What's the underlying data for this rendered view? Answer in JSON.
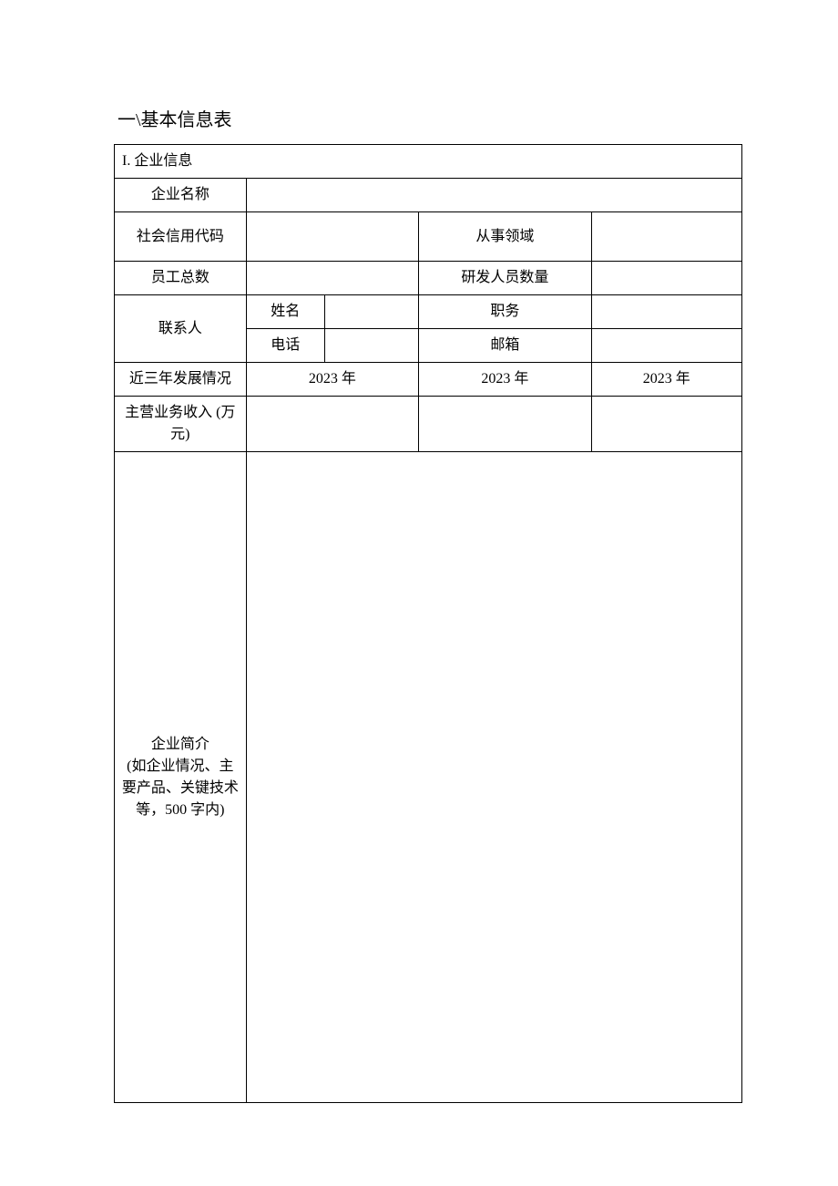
{
  "title": "一\\基本信息表",
  "section": "I. 企业信息",
  "labels": {
    "companyName": "企业名称",
    "creditCode": "社会信用代码",
    "field": "从事领域",
    "employeeCount": "员工总数",
    "rdCount": "研发人员数量",
    "contact": "联系人",
    "name": "姓名",
    "position": "职务",
    "phone": "电话",
    "email": "邮箱",
    "threeYear": "近三年发展情况",
    "year1": "2023 年",
    "year2": "2023 年",
    "year3": "2023 年",
    "revenue": "主营业务收入 (万元)",
    "intro": "企业简介\n (如企业情况、主要产品、关键技术等，500 字内)"
  },
  "values": {
    "companyName": "",
    "creditCode": "",
    "field": "",
    "employeeCount": "",
    "rdCount": "",
    "contactName": "",
    "contactPosition": "",
    "contactPhone": "",
    "contactEmail": "",
    "revenueY1": "",
    "revenueY2": "",
    "revenueY3": "",
    "intro": ""
  }
}
